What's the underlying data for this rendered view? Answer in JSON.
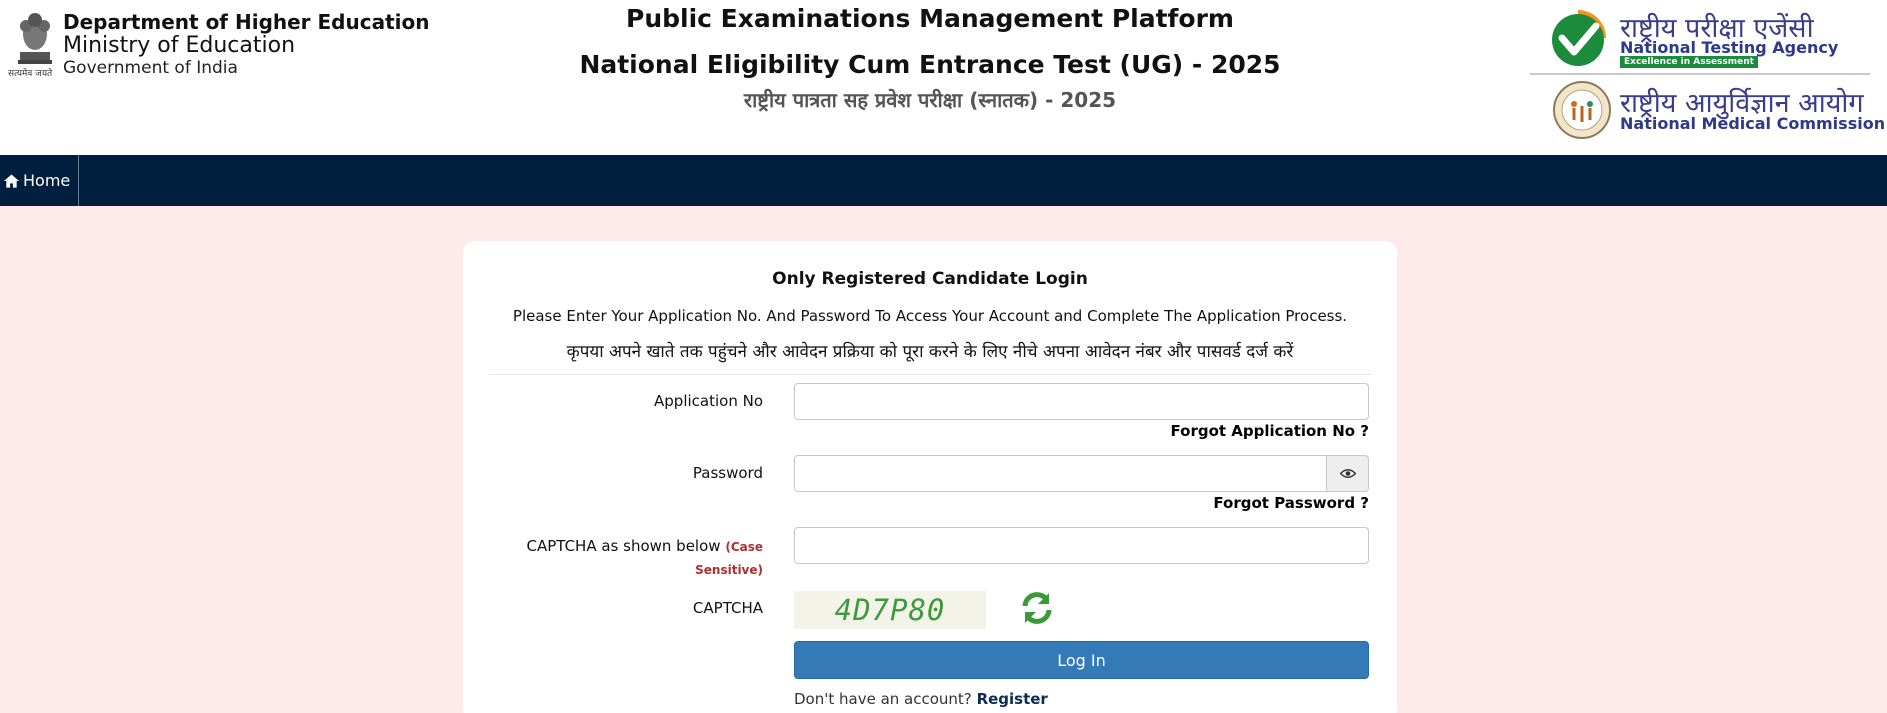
{
  "header": {
    "emblem_caption": "सत्यमेव जयते",
    "dept_line1": "Department of Higher Education",
    "dept_line2": "Ministry of Education",
    "dept_line3": "Government of India",
    "title1": "Public Examinations Management Platform",
    "title2": "National Eligibility Cum Entrance Test (UG) - 2025",
    "title3": "राष्ट्रीय पात्रता सह प्रवेश परीक्षा (स्नातक) - 2025",
    "nta_hindi": "राष्ट्रीय परीक्षा एजेंसी",
    "nta_english": "National Testing Agency",
    "nta_tagline": "Excellence in Assessment",
    "nmc_hindi": "राष्ट्रीय आयुर्विज्ञान आयोग",
    "nmc_english": "National Medical Commission"
  },
  "nav": {
    "home_label": "Home"
  },
  "login": {
    "title": "Only Registered Candidate Login",
    "instruction_en": "Please Enter Your Application No. And Password To Access Your Account and Complete The Application Process.",
    "instruction_hi": "कृपया अपने खाते तक पहुंचने और आवेदन प्रक्रिया को पूरा करने के लिए नीचे अपना आवेदन नंबर और पासवर्ड दर्ज करें",
    "app_no_label": "Application No",
    "app_no_value": "",
    "forgot_app_no": "Forgot Application No ?",
    "password_label": "Password",
    "password_value": "",
    "forgot_password": "Forgot Password ?",
    "captcha_input_label": "CAPTCHA as shown below",
    "captcha_case_note": "(Case Sensitive)",
    "captcha_input_value": "",
    "captcha_label": "CAPTCHA",
    "captcha_text": "4D7P80",
    "login_button": "Log In",
    "no_account_text": "Don't have an account?",
    "register_link": "Register"
  },
  "colors": {
    "navbar": "#001f3f",
    "page_background": "#fdeaea",
    "login_button": "#337ab7",
    "case_note": "#b03030"
  },
  "icons": {
    "home": "home-icon",
    "eye": "eye-icon",
    "refresh": "refresh-icon"
  }
}
